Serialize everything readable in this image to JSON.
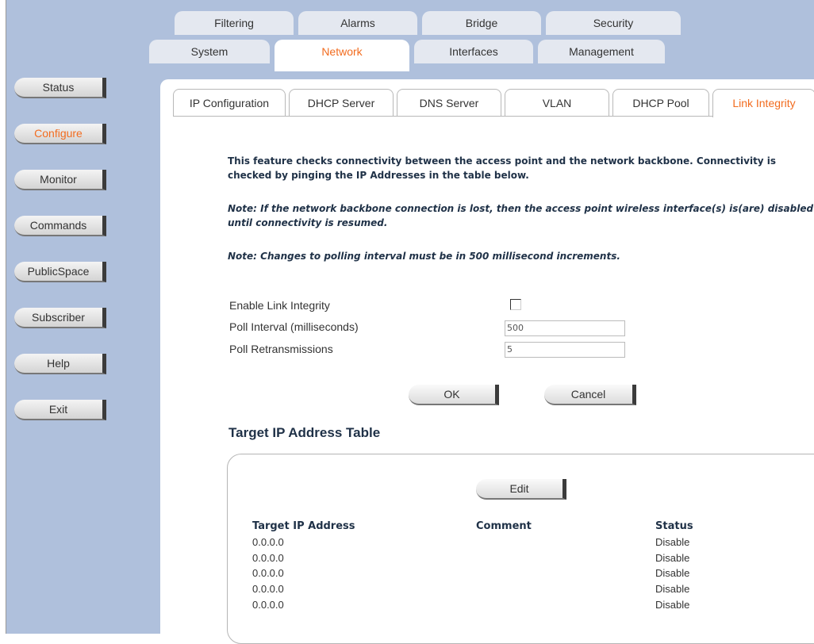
{
  "top_tabs_row1": [
    "Filtering",
    "Alarms",
    "Bridge",
    "Security"
  ],
  "top_tabs_row2": [
    "System",
    "Network",
    "Interfaces",
    "Management"
  ],
  "sidebar": [
    "Status",
    "Configure",
    "Monitor",
    "Commands",
    "PublicSpace",
    "Subscriber",
    "Help",
    "Exit"
  ],
  "sub_tabs": [
    "IP Configuration",
    "DHCP Server",
    "DNS Server",
    "VLAN",
    "DHCP Pool",
    "Link Integrity"
  ],
  "intro": "This feature checks connectivity between the access point and the network backbone. Connectivity is checked by pinging the IP Addresses in the table below.",
  "note1": "Note: If the network backbone connection is lost, then the access point wireless interface(s) is(are) disabled until connectivity is resumed.",
  "note2": "Note: Changes to polling interval must be in 500 millisecond increments.",
  "form": {
    "enable_label": "Enable Link Integrity",
    "poll_interval_label": "Poll Interval (milliseconds)",
    "poll_interval_value": "500",
    "poll_retrans_label": "Poll Retransmissions",
    "poll_retrans_value": "5",
    "ok": "OK",
    "cancel": "Cancel"
  },
  "table": {
    "title": "Target IP Address Table",
    "edit": "Edit",
    "headers": [
      "Target IP Address",
      "Comment",
      "Status"
    ],
    "rows": [
      [
        "0.0.0.0",
        "",
        "Disable"
      ],
      [
        "0.0.0.0",
        "",
        "Disable"
      ],
      [
        "0.0.0.0",
        "",
        "Disable"
      ],
      [
        "0.0.0.0",
        "",
        "Disable"
      ],
      [
        "0.0.0.0",
        "",
        "Disable"
      ]
    ]
  },
  "colors": {
    "accent": "#f26c1f",
    "sidebar_bg": "#afc0dc",
    "heading": "#1f3147"
  }
}
